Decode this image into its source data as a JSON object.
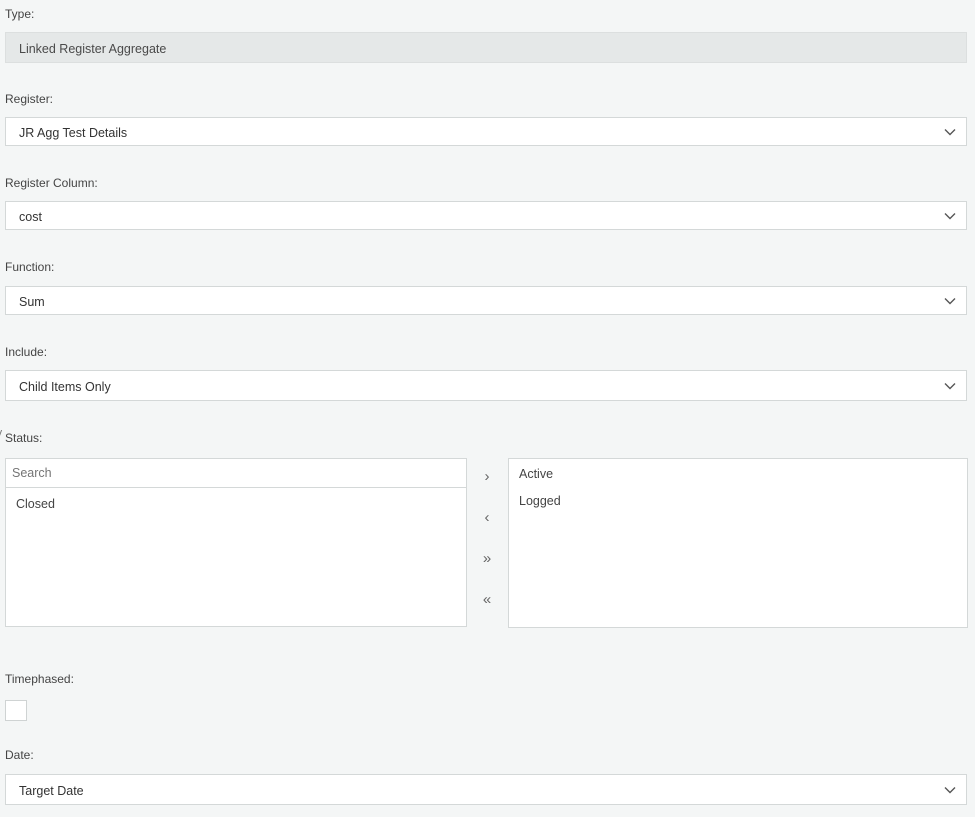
{
  "type": {
    "label": "Type:",
    "value": "Linked Register Aggregate"
  },
  "register": {
    "label": "Register:",
    "value": "JR Agg Test Details"
  },
  "register_column": {
    "label": "Register Column:",
    "value": "cost"
  },
  "function": {
    "label": "Function:",
    "value": "Sum"
  },
  "include": {
    "label": "Include:",
    "value": "Child Items Only"
  },
  "status": {
    "label": "Status:",
    "search_placeholder": "Search",
    "available": [
      "Closed"
    ],
    "selected": [
      "Active",
      "Logged"
    ],
    "buttons": {
      "add": "›",
      "remove": "‹",
      "add_all": "»",
      "remove_all": "«"
    }
  },
  "timephased": {
    "label": "Timephased:",
    "checked": false
  },
  "date": {
    "label": "Date:",
    "value": "Target Date"
  },
  "icons": {
    "dropdown": "chevron-down-icon"
  }
}
